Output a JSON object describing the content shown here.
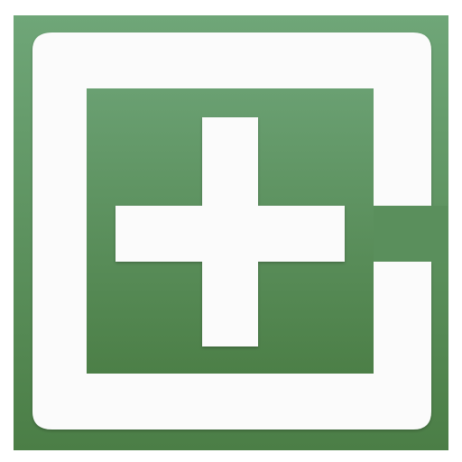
{
  "icon": {
    "name": "medical-cross-app-icon",
    "colors": {
      "green_light": "#6da374",
      "green_dark": "#4a7d45",
      "white": "#fbfbfb",
      "background": "#ffffff"
    }
  }
}
